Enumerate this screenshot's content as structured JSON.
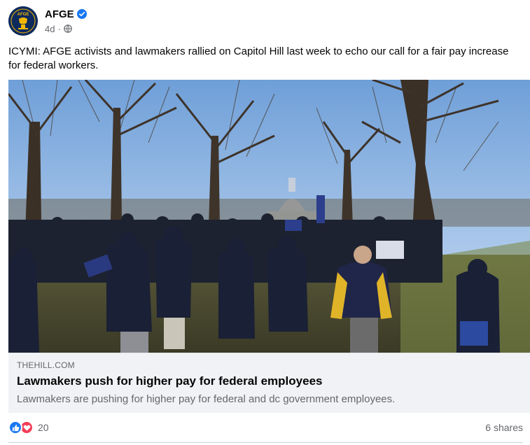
{
  "post": {
    "author": "AFGE",
    "avatar_text": "AFGE",
    "time": "4d",
    "separator": "·",
    "text": "ICYMI: AFGE activists and lawmakers rallied on Capitol Hill last week to echo our call for a fair pay increase for federal workers."
  },
  "link": {
    "domain": "THEHILL.COM",
    "title": "Lawmakers push for higher pay for federal employees",
    "description": "Lawmakers are pushing for higher pay for federal and dc government employees."
  },
  "stats": {
    "reaction_count": "20",
    "shares": "6 shares"
  },
  "colors": {
    "verified": "#1877f2",
    "like": "#1877f2",
    "love": "#f33e58",
    "avatar_bg": "#0d2a5c",
    "avatar_accent": "#f2b705"
  },
  "icons": {
    "verified": "verified-badge-icon",
    "privacy": "globe-icon",
    "like": "like-thumb-icon",
    "love": "love-heart-icon"
  }
}
